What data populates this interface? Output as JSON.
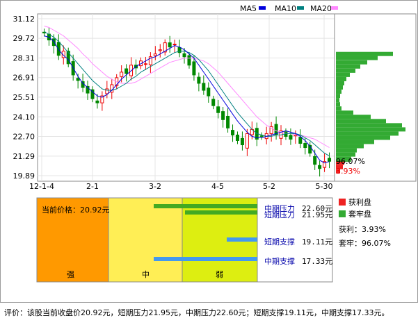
{
  "legend": [
    {
      "name": "MA5",
      "color": "#0000dd"
    },
    {
      "name": "MA10",
      "color": "#008080"
    },
    {
      "name": "MA20",
      "color": "#ff88ff"
    }
  ],
  "chart_data": {
    "type": "candlestick",
    "y_ticks": [
      "31.12",
      "29.72",
      "28.31",
      "26.91",
      "25.51",
      "24.10",
      "22.70",
      "21.29",
      "19.89"
    ],
    "x_ticks": [
      "12-1-4",
      "2-1",
      "3-2",
      "4-5",
      "5-2",
      "5-30"
    ],
    "ylim": [
      19.89,
      31.12
    ],
    "current_price": 20.92,
    "ma5": [
      29.9,
      29.8,
      29.5,
      28.9,
      28.5,
      28.2,
      27.6,
      27.0,
      26.5,
      26.2,
      25.9,
      25.6,
      25.5,
      25.7,
      26.0,
      26.4,
      26.8,
      27.1,
      27.4,
      27.7,
      27.9,
      28.1,
      28.3,
      28.4,
      28.6,
      28.8,
      29.0,
      29.2,
      29.1,
      28.9,
      28.6,
      28.3,
      27.8,
      27.3,
      26.8,
      26.3,
      25.8,
      25.3,
      24.8,
      24.3,
      23.8,
      23.4,
      23.0,
      22.7,
      22.6,
      22.6,
      22.7,
      22.8,
      22.9,
      23.0,
      23.1,
      23.0,
      22.9,
      22.7,
      22.4,
      22.0,
      21.5,
      21.0,
      20.8,
      20.9
    ],
    "ma10": [
      30.2,
      30.0,
      29.8,
      29.5,
      29.1,
      28.7,
      28.3,
      27.9,
      27.5,
      27.1,
      26.7,
      26.4,
      26.1,
      26.0,
      26.0,
      26.1,
      26.3,
      26.5,
      26.8,
      27.0,
      27.3,
      27.5,
      27.7,
      27.9,
      28.1,
      28.3,
      28.5,
      28.7,
      28.8,
      28.8,
      28.7,
      28.5,
      28.2,
      27.8,
      27.4,
      26.9,
      26.4,
      25.9,
      25.4,
      24.9,
      24.4,
      24.0,
      23.6,
      23.2,
      22.9,
      22.8,
      22.7,
      22.7,
      22.8,
      22.8,
      22.9,
      22.9,
      22.9,
      22.8,
      22.6,
      22.4,
      22.1,
      21.8,
      21.5,
      21.3
    ],
    "ma20": [
      30.6,
      30.5,
      30.3,
      30.1,
      29.9,
      29.6,
      29.3,
      29.0,
      28.6,
      28.3,
      27.9,
      27.6,
      27.3,
      27.0,
      26.8,
      26.6,
      26.5,
      26.5,
      26.5,
      26.6,
      26.8,
      27.0,
      27.2,
      27.4,
      27.6,
      27.8,
      28.0,
      28.1,
      28.2,
      28.3,
      28.3,
      28.3,
      28.2,
      28.1,
      27.9,
      27.6,
      27.3,
      26.9,
      26.5,
      26.1,
      25.7,
      25.3,
      24.9,
      24.5,
      24.1,
      23.8,
      23.5,
      23.3,
      23.1,
      23.0,
      22.9,
      22.9,
      22.8,
      22.8,
      22.7,
      22.6,
      22.5,
      22.3,
      22.1,
      21.9
    ],
    "close": [
      30.1,
      29.6,
      29.2,
      28.5,
      28.8,
      27.9,
      27.1,
      26.7,
      26.2,
      25.8,
      25.4,
      25.1,
      25.6,
      26.1,
      26.4,
      26.9,
      27.3,
      27.2,
      27.8,
      27.6,
      28.1,
      27.9,
      28.4,
      28.6,
      28.9,
      29.4,
      29.1,
      29.3,
      28.7,
      28.4,
      27.8,
      27.1,
      26.5,
      26.0,
      25.6,
      24.9,
      24.4,
      23.9,
      23.3,
      22.8,
      22.4,
      22.1,
      22.9,
      23.2,
      22.5,
      22.7,
      22.9,
      23.4,
      22.8,
      23.1,
      22.7,
      22.5,
      22.8,
      22.2,
      21.9,
      21.5,
      20.7,
      20.4,
      20.9,
      20.92
    ],
    "volume_profile": [
      {
        "price": 28.6,
        "size": 0.82
      },
      {
        "price": 28.31,
        "size": 0.6
      },
      {
        "price": 28.0,
        "size": 0.45
      },
      {
        "price": 27.7,
        "size": 0.35
      },
      {
        "price": 27.4,
        "size": 0.28
      },
      {
        "price": 27.1,
        "size": 0.2
      },
      {
        "price": 26.8,
        "size": 0.15
      },
      {
        "price": 26.5,
        "size": 0.12
      },
      {
        "price": 26.2,
        "size": 0.1
      },
      {
        "price": 25.9,
        "size": 0.08
      },
      {
        "price": 25.6,
        "size": 0.06
      },
      {
        "price": 25.3,
        "size": 0.05
      },
      {
        "price": 25.0,
        "size": 0.06
      },
      {
        "price": 24.7,
        "size": 0.08
      },
      {
        "price": 24.4,
        "size": 0.25
      },
      {
        "price": 24.1,
        "size": 0.5
      },
      {
        "price": 23.8,
        "size": 0.72
      },
      {
        "price": 23.5,
        "size": 0.95
      },
      {
        "price": 23.2,
        "size": 1.0
      },
      {
        "price": 22.9,
        "size": 0.9
      },
      {
        "price": 22.6,
        "size": 0.78
      },
      {
        "price": 22.3,
        "size": 0.55
      },
      {
        "price": 22.0,
        "size": 0.4
      },
      {
        "price": 21.7,
        "size": 0.3
      },
      {
        "price": 21.4,
        "size": 0.28
      },
      {
        "price": 21.1,
        "size": 0.22
      },
      {
        "price": 20.8,
        "size": 0.12
      },
      {
        "price": 20.5,
        "size": 0.1
      },
      {
        "price": 20.2,
        "size": 0.06
      }
    ],
    "profit_pct_label": "96.07%",
    "loss_pct_label": "3.93%"
  },
  "panel": {
    "current_price_label": "当前价格：20.92元",
    "zones": [
      "强",
      "中",
      "弱"
    ],
    "levels": [
      {
        "name": "中期压力",
        "value": "22.60元",
        "value_num": 22.6,
        "color": "#44aa22"
      },
      {
        "name": "短期压力",
        "value": "21.95元",
        "value_num": 21.95,
        "color": "#44aa22"
      },
      {
        "name": "短期支撑",
        "value": "19.11元",
        "value_num": 19.11,
        "color": "#4499ee"
      },
      {
        "name": "中期支撑",
        "value": "17.33元",
        "value_num": 17.33,
        "color": "#4499ee"
      }
    ]
  },
  "side_legend": {
    "profit_label": "获利盘",
    "trapped_label": "套牢盘",
    "profit_text": "获利：3.93%",
    "trapped_text": "套牢：96.07%"
  },
  "footer": "评价：该股当前收盘价20.92元，短期压力21.95元，中期压力22.60元；短期支撑19.11元，中期支撑17.33元。"
}
